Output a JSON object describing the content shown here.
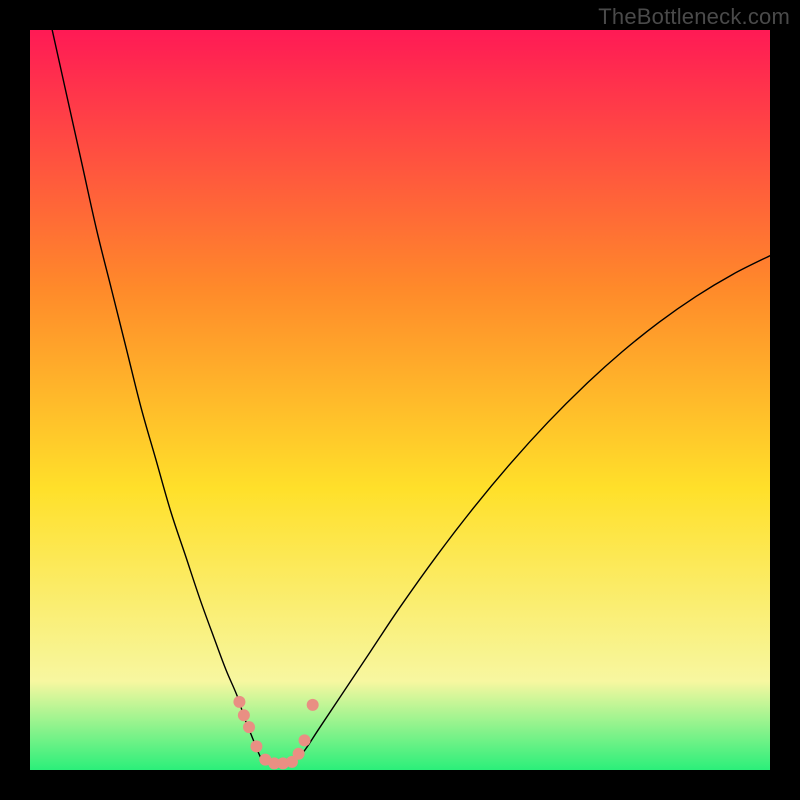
{
  "watermark": "TheBottleneck.com",
  "chart_data": {
    "type": "line",
    "title": "",
    "xlabel": "",
    "ylabel": "",
    "xlim": [
      0,
      100
    ],
    "ylim": [
      0,
      100
    ],
    "grid": false,
    "background_gradient": {
      "top": "#ff1a55",
      "upper_mid": "#ff8a2a",
      "mid": "#ffe02a",
      "lower_mid": "#f7f7a0",
      "bottom": "#2bef7a"
    },
    "series": [
      {
        "name": "left-branch",
        "color": "#000000",
        "stroke_width": 1.4,
        "x": [
          3,
          5,
          7,
          9,
          11,
          13,
          15,
          17,
          19,
          21,
          23,
          25,
          26.5,
          28,
          29,
          30,
          30.8,
          31.5
        ],
        "y": [
          100,
          91,
          82,
          73,
          65,
          57,
          49,
          42,
          35,
          29,
          23,
          17.5,
          13.5,
          10,
          7,
          4.5,
          2.5,
          1.0
        ]
      },
      {
        "name": "right-branch",
        "color": "#000000",
        "stroke_width": 1.4,
        "x": [
          35.5,
          37,
          39,
          42,
          46,
          50,
          55,
          60,
          65,
          70,
          75,
          80,
          85,
          90,
          95,
          100
        ],
        "y": [
          1.0,
          2.5,
          5.5,
          10,
          16,
          22,
          29,
          35.5,
          41.5,
          47,
          52,
          56.5,
          60.5,
          64,
          67,
          69.5
        ]
      },
      {
        "name": "marker-dots",
        "type": "scatter",
        "color": "#e98f83",
        "radius": 6,
        "x": [
          28.3,
          28.9,
          29.6,
          30.6,
          31.8,
          33.0,
          34.2,
          35.4,
          36.3,
          37.1,
          38.2
        ],
        "y": [
          9.2,
          7.4,
          5.8,
          3.2,
          1.4,
          0.9,
          0.9,
          1.1,
          2.2,
          4.0,
          8.8
        ]
      }
    ]
  }
}
